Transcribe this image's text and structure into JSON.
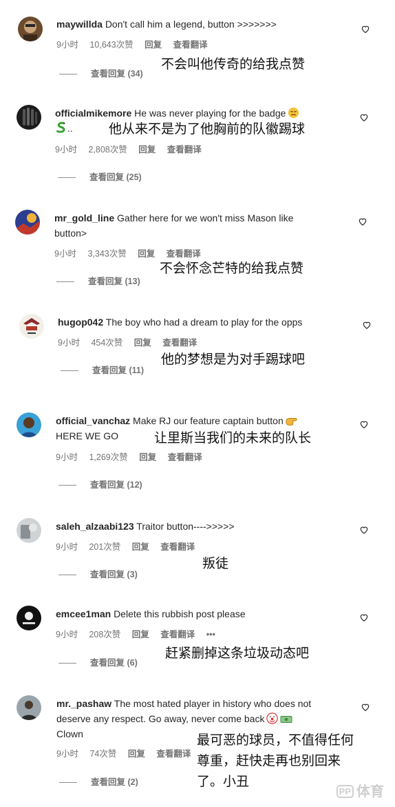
{
  "comments": [
    {
      "username": "maywillda",
      "text": "Don't call him a legend, button >>>>>>>",
      "time": "9小时",
      "likes": "10,643次赞",
      "reply": "回复",
      "translate": "查看翻译",
      "view_replies": "查看回复 (34)",
      "caption_cn": "不会叫他传奇的给我点赞"
    },
    {
      "username": "officialmikemore",
      "text": "He was never playing for the badge",
      "text2": "..",
      "time": "9小时",
      "likes": "2,808次赞",
      "reply": "回复",
      "translate": "查看翻译",
      "view_replies": "查看回复 (25)",
      "caption_cn": "他从来不是为了他胸前的队徽踢球"
    },
    {
      "username": "mr_gold_line",
      "text": "Gather here for we won't miss Mason like",
      "text2": "button>",
      "time": "9小时",
      "likes": "3,343次赞",
      "reply": "回复",
      "translate": "查看翻译",
      "view_replies": "查看回复 (13)",
      "caption_cn": "不会怀念芒特的给我点赞"
    },
    {
      "username": "hugop042",
      "text": "The boy who had a dream to play for the opps",
      "time": "9小时",
      "likes": "454次赞",
      "reply": "回复",
      "translate": "查看翻译",
      "view_replies": "查看回复 (11)",
      "caption_cn": "他的梦想是为对手踢球吧"
    },
    {
      "username": "official_vanchaz",
      "text": "Make RJ our feature captain button",
      "text2": "HERE WE GO",
      "time": "9小时",
      "likes": "1,269次赞",
      "reply": "回复",
      "translate": "查看翻译",
      "view_replies": "查看回复 (12)",
      "caption_cn": "让里斯当我们的未来的队长"
    },
    {
      "username": "saleh_alzaabi123",
      "text": "Traitor button---->>>>>",
      "time": "9小时",
      "likes": "201次赞",
      "reply": "回复",
      "translate": "查看翻译",
      "view_replies": "查看回复 (3)",
      "caption_cn": "叛徒"
    },
    {
      "username": "emcee1man",
      "text": "Delete this rubbish post please",
      "time": "9小时",
      "likes": "208次赞",
      "reply": "回复",
      "translate": "查看翻译",
      "more": "•••",
      "view_replies": "查看回复 (6)",
      "caption_cn": "赶紧删掉这条垃圾动态吧"
    },
    {
      "username": "mr._pashaw",
      "text": "The most hated player in history who does not",
      "text2": "deserve any respect. Go away, never come back",
      "text3": "Clown",
      "time": "9小时",
      "likes": "74次赞",
      "reply": "回复",
      "translate": "查看翻译",
      "view_replies": "查看回复 (2)",
      "caption_cn_1": "最可恶的球员，不值得任何",
      "caption_cn_2": "尊重，赶快走再也别回来",
      "caption_cn_3": "了。小丑"
    }
  ],
  "watermark": {
    "logo": "PP",
    "text": "体育"
  },
  "colors": {
    "text": "#262626",
    "meta": "#737373",
    "background": "#ffffff"
  }
}
